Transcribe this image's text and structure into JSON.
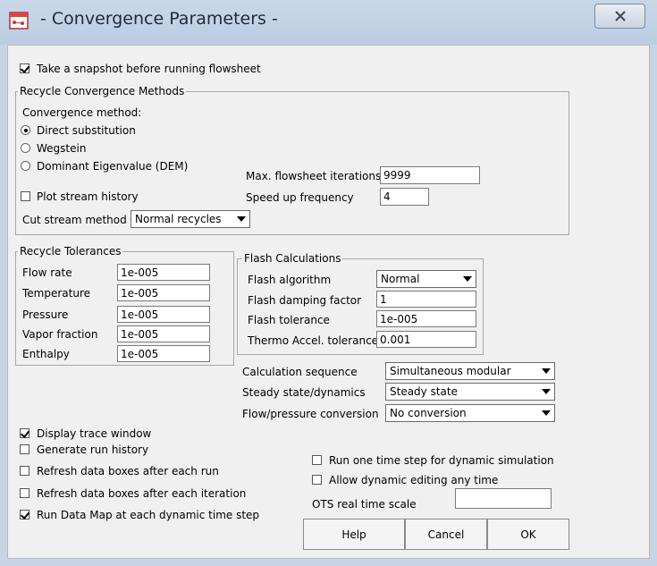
{
  "window": {
    "title": "- Convergence Parameters -",
    "icon": "app-icon",
    "close": "close-icon"
  },
  "snapshot": {
    "label": "Take a snapshot before running flowsheet",
    "checked": true
  },
  "recycle_methods": {
    "group_label": "Recycle Convergence Methods",
    "method_label": "Convergence method:",
    "options": [
      {
        "label": "Direct substitution",
        "selected": true
      },
      {
        "label": "Wegstein",
        "selected": false
      },
      {
        "label": "Dominant Eigenvalue (DEM)",
        "selected": false
      }
    ],
    "plot_history": {
      "label": "Plot stream history",
      "checked": false
    },
    "cut_stream_label": "Cut stream method",
    "cut_stream_value": "Normal recycles",
    "max_iter_label": "Max. flowsheet iterations",
    "max_iter_value": "9999",
    "speedup_label": "Speed up frequency",
    "speedup_value": "4"
  },
  "tolerances": {
    "group_label": "Recycle Tolerances",
    "rows": [
      {
        "label": "Flow rate",
        "value": "1e-005"
      },
      {
        "label": "Temperature",
        "value": "1e-005"
      },
      {
        "label": "Pressure",
        "value": "1e-005"
      },
      {
        "label": "Vapor fraction",
        "value": "1e-005"
      },
      {
        "label": "Enthalpy",
        "value": "1e-005"
      }
    ]
  },
  "flash": {
    "group_label": "Flash Calculations",
    "algorithm_label": "Flash algorithm",
    "algorithm_value": "Normal",
    "damping_label": "Flash damping factor",
    "damping_value": "1",
    "tolerance_label": "Flash tolerance",
    "tolerance_value": "1e-005",
    "thermo_label": "Thermo Accel. tolerance",
    "thermo_value": "0.001"
  },
  "sequence": {
    "calc_label": "Calculation sequence",
    "calc_value": "Simultaneous modular",
    "steady_label": "Steady state/dynamics",
    "steady_value": "Steady state",
    "flow_label": "Flow/pressure conversion",
    "flow_value": "No conversion"
  },
  "options_left": [
    {
      "label": "Display trace window",
      "checked": true
    },
    {
      "label": "Generate run history",
      "checked": false
    },
    {
      "label": "Refresh data boxes after each run",
      "checked": false
    },
    {
      "label": "Refresh data boxes after each iteration",
      "checked": false
    },
    {
      "label": "Run Data Map at each dynamic time step",
      "checked": true
    }
  ],
  "options_right": [
    {
      "label": "Run one time step for dynamic simulation",
      "checked": false
    },
    {
      "label": "Allow dynamic editing any time",
      "checked": false
    }
  ],
  "ots": {
    "label": "OTS real time scale",
    "value": ""
  },
  "buttons": {
    "help": "Help",
    "cancel": "Cancel",
    "ok": "OK"
  }
}
